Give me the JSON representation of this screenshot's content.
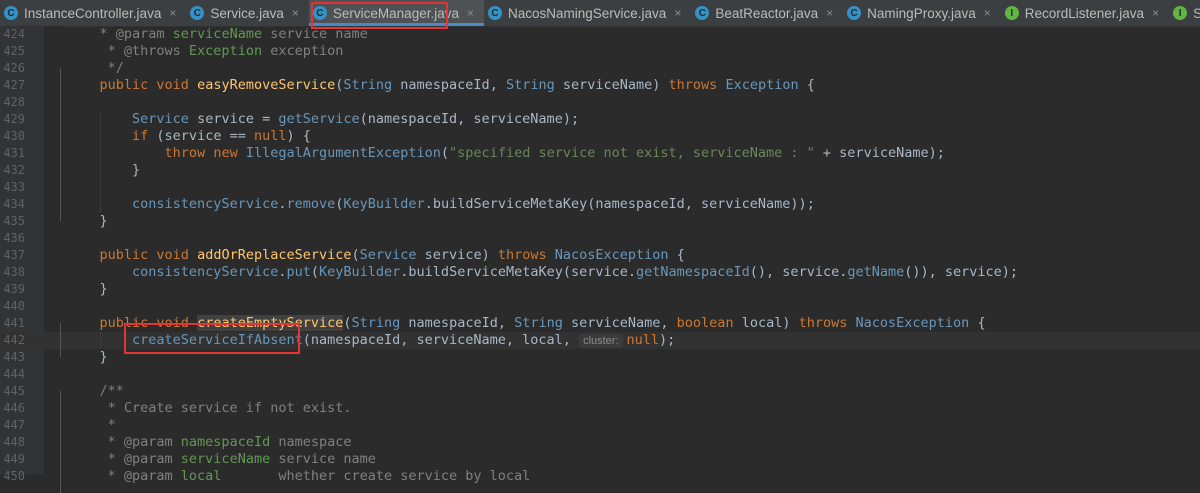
{
  "tabs": [
    {
      "label": "InstanceController.java",
      "icon": "C",
      "active": false
    },
    {
      "label": "Service.java",
      "icon": "C",
      "active": false
    },
    {
      "label": "ServiceManager.java",
      "icon": "C",
      "active": true
    },
    {
      "label": "NacosNamingService.java",
      "icon": "C",
      "active": false
    },
    {
      "label": "BeatReactor.java",
      "icon": "C",
      "active": false
    },
    {
      "label": "NamingProxy.java",
      "icon": "C",
      "active": false
    },
    {
      "label": "RecordListener.java",
      "icon": "I",
      "active": false
    },
    {
      "label": "Schedule",
      "icon": "I",
      "active": false
    }
  ],
  "tab_close_glyph": "×",
  "editor": {
    "current_line": 442,
    "lines": [
      {
        "n": "424",
        "t": [
          [
            "    ",
            ""
          ],
          [
            "* @param ",
            "c"
          ],
          [
            "serviceName",
            "ct"
          ],
          [
            " service name",
            "c"
          ]
        ]
      },
      {
        "n": "425",
        "t": [
          [
            "     ",
            ""
          ],
          [
            "* @throws ",
            "c"
          ],
          [
            "Exception",
            "ct"
          ],
          [
            " exception",
            "c"
          ]
        ]
      },
      {
        "n": "426",
        "t": [
          [
            "     */",
            "c"
          ]
        ]
      },
      {
        "n": "427",
        "t": [
          [
            "    ",
            ""
          ],
          [
            "public void ",
            "k"
          ],
          [
            "easyRemoveService",
            "f"
          ],
          [
            "(",
            ""
          ],
          [
            "String",
            "t"
          ],
          [
            " namespaceId, ",
            ""
          ],
          [
            "String",
            "t"
          ],
          [
            " serviceName) ",
            ""
          ],
          [
            "throws ",
            "k"
          ],
          [
            "Exception",
            "t"
          ],
          [
            " {",
            ""
          ]
        ]
      },
      {
        "n": "428",
        "t": []
      },
      {
        "n": "429",
        "t": [
          [
            "        ",
            ""
          ],
          [
            "Service",
            "t"
          ],
          [
            " service = ",
            ""
          ],
          [
            "getService",
            "fm"
          ],
          [
            "(namespaceId, serviceName);",
            ""
          ]
        ]
      },
      {
        "n": "430",
        "t": [
          [
            "        ",
            ""
          ],
          [
            "if",
            "k"
          ],
          [
            " (service == ",
            ""
          ],
          [
            "null",
            "k"
          ],
          [
            ") {",
            ""
          ]
        ]
      },
      {
        "n": "431",
        "t": [
          [
            "            ",
            ""
          ],
          [
            "throw new ",
            "k"
          ],
          [
            "IllegalArgumentException",
            "t"
          ],
          [
            "(",
            ""
          ],
          [
            "\"specified service not exist, serviceName : \"",
            "s"
          ],
          [
            " + serviceName);",
            ""
          ]
        ]
      },
      {
        "n": "432",
        "t": [
          [
            "        }",
            ""
          ]
        ]
      },
      {
        "n": "433",
        "t": []
      },
      {
        "n": "434",
        "t": [
          [
            "        ",
            ""
          ],
          [
            "consistencyService",
            "fm"
          ],
          [
            ".",
            ""
          ],
          [
            "remove",
            "fm"
          ],
          [
            "(",
            ""
          ],
          [
            "KeyBuilder",
            "t"
          ],
          [
            ".buildServiceMetaKey(namespaceId, serviceName));",
            ""
          ]
        ]
      },
      {
        "n": "435",
        "t": [
          [
            "    }",
            ""
          ]
        ]
      },
      {
        "n": "436",
        "t": []
      },
      {
        "n": "437",
        "t": [
          [
            "    ",
            ""
          ],
          [
            "public void ",
            "k"
          ],
          [
            "addOrReplaceService",
            "f"
          ],
          [
            "(",
            ""
          ],
          [
            "Service",
            "t"
          ],
          [
            " service) ",
            ""
          ],
          [
            "throws ",
            "k"
          ],
          [
            "NacosException",
            "t"
          ],
          [
            " {",
            ""
          ]
        ]
      },
      {
        "n": "438",
        "t": [
          [
            "        ",
            ""
          ],
          [
            "consistencyService",
            "fm"
          ],
          [
            ".",
            ""
          ],
          [
            "put",
            "fm"
          ],
          [
            "(",
            ""
          ],
          [
            "KeyBuilder",
            "t"
          ],
          [
            ".buildServiceMetaKey(service.",
            ""
          ],
          [
            "getNamespaceId",
            "fm"
          ],
          [
            "(), service.",
            ""
          ],
          [
            "getName",
            "fm"
          ],
          [
            "()), service);",
            ""
          ]
        ]
      },
      {
        "n": "439",
        "t": [
          [
            "    }",
            ""
          ]
        ]
      },
      {
        "n": "440",
        "t": []
      },
      {
        "n": "441",
        "t": [
          [
            "    ",
            ""
          ],
          [
            "public void ",
            "k"
          ],
          [
            "createEmptyService",
            "f sel"
          ],
          [
            "(",
            ""
          ],
          [
            "String",
            "t"
          ],
          [
            " namespaceId, ",
            ""
          ],
          [
            "String",
            "t"
          ],
          [
            " serviceName, ",
            ""
          ],
          [
            "boolean",
            "k"
          ],
          [
            " local) ",
            ""
          ],
          [
            "throws ",
            "k"
          ],
          [
            "NacosException",
            "t"
          ],
          [
            " {",
            ""
          ]
        ]
      },
      {
        "n": "442",
        "t": [
          [
            "        ",
            ""
          ],
          [
            "createServiceIfAbsent",
            "fm"
          ],
          [
            "(namespaceId, serviceName, local, ",
            ""
          ],
          [
            "cluster:",
            "hint"
          ],
          [
            "null",
            "k"
          ],
          [
            ");",
            ""
          ]
        ]
      },
      {
        "n": "443",
        "t": [
          [
            "    }",
            ""
          ]
        ]
      },
      {
        "n": "444",
        "t": []
      },
      {
        "n": "445",
        "t": [
          [
            "    /**",
            "c"
          ]
        ]
      },
      {
        "n": "446",
        "t": [
          [
            "     * Create service if not exist.",
            "c"
          ]
        ]
      },
      {
        "n": "447",
        "t": [
          [
            "     *",
            "c"
          ]
        ]
      },
      {
        "n": "448",
        "t": [
          [
            "     ",
            ""
          ],
          [
            "* @param ",
            "c"
          ],
          [
            "namespaceId",
            "ct"
          ],
          [
            " namespace",
            "c"
          ]
        ]
      },
      {
        "n": "449",
        "t": [
          [
            "     ",
            ""
          ],
          [
            "* @param ",
            "c"
          ],
          [
            "serviceName",
            "ct"
          ],
          [
            " service name",
            "c"
          ]
        ]
      },
      {
        "n": "450",
        "t": [
          [
            "     ",
            ""
          ],
          [
            "* @param ",
            "c"
          ],
          [
            "local",
            "ct"
          ],
          [
            "       whether create service by local",
            "c"
          ]
        ]
      }
    ]
  },
  "colors": {
    "background": "#2b2b2b",
    "keyword": "#cc7832",
    "type": "#6897bb",
    "method_decl": "#ffc66d",
    "string": "#6a8759",
    "comment": "#808080",
    "annotation_box": "#e23636"
  }
}
